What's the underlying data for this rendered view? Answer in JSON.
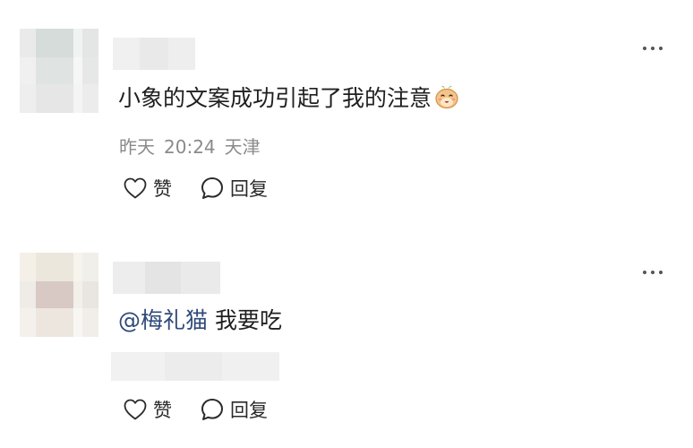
{
  "comments": [
    {
      "text": "小象的文案成功引起了我的注意",
      "emoji_icon": "smiling-bun-emoji-icon",
      "meta": {
        "date": "昨天",
        "time": "20:24",
        "location": "天津"
      },
      "actions": {
        "like_label": "赞",
        "reply_label": "回复"
      }
    },
    {
      "mention": "@梅礼猫",
      "text": " 我要吃",
      "actions": {
        "like_label": "赞",
        "reply_label": "回复"
      }
    }
  ],
  "colors": {
    "text": "#1f1f1f",
    "meta": "#8a8a8a",
    "mention": "#2f4a7a",
    "icon": "#2a2a2a"
  }
}
